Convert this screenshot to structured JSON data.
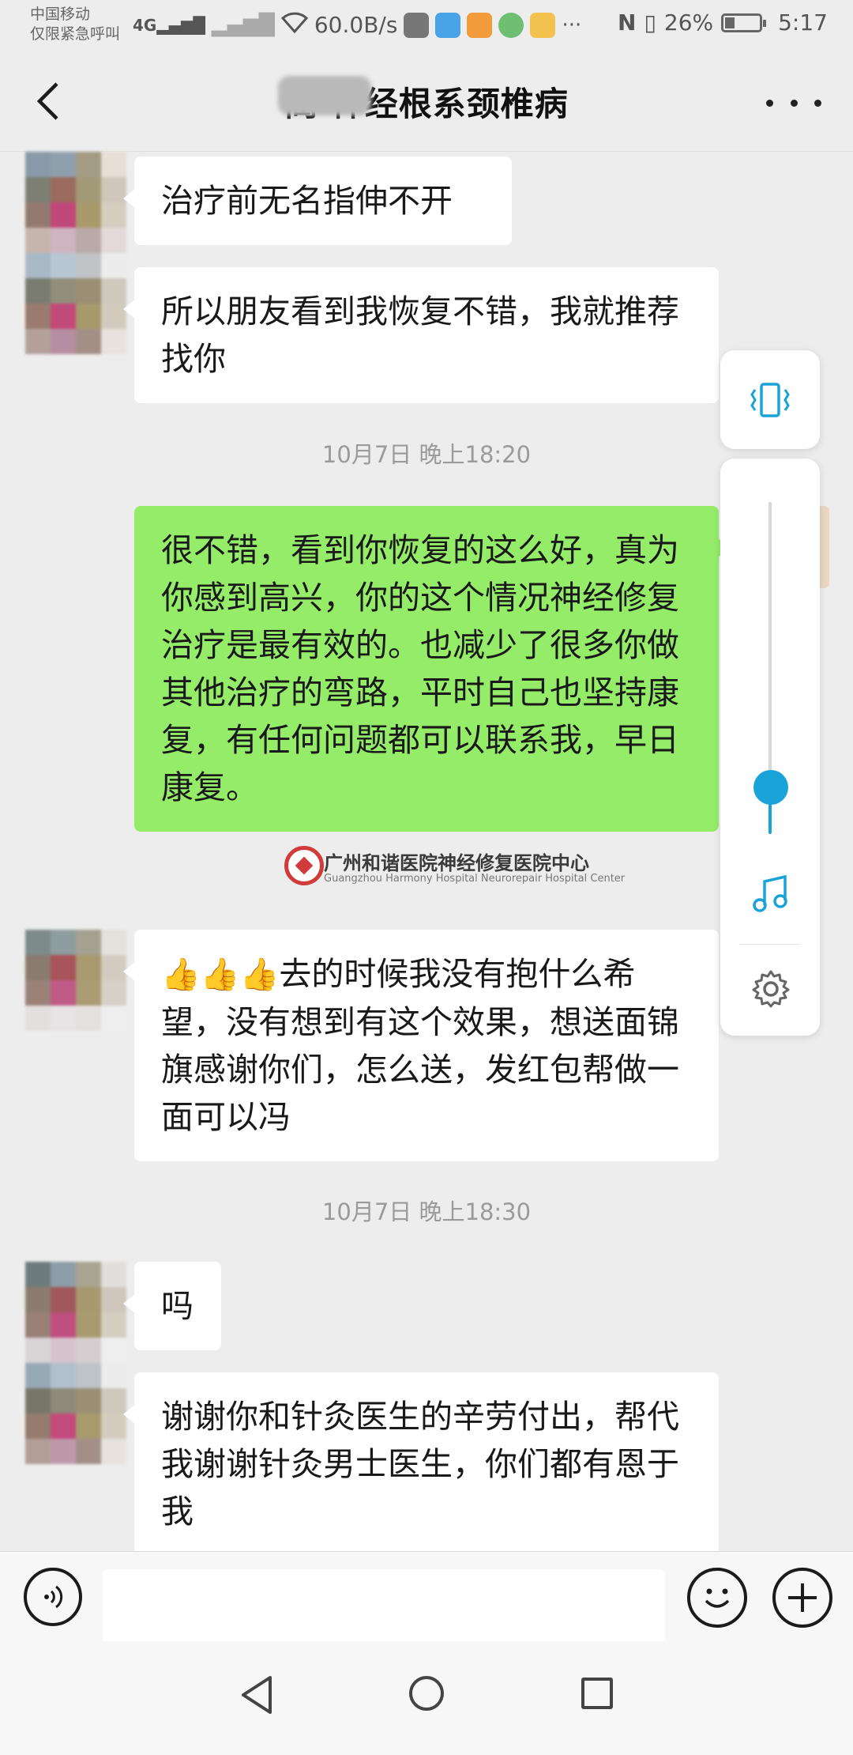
{
  "status_bar": {
    "carrier_line1": "中国移动",
    "carrier_line2": "仅限紧急呼叫",
    "network": "4G",
    "speed": "60.0B/s",
    "overflow": "···",
    "battery_pct": "26%",
    "time": "5:17",
    "icons": [
      "signal-icon",
      "wifi-icon",
      "wechat-icon",
      "weibo-icon",
      "nfc-icon",
      "vibrate-icon",
      "battery-icon"
    ]
  },
  "header": {
    "title": "蔺           神经根系颈椎病",
    "back_icon": "chevron-left-icon",
    "more_icon": "more-dots-icon"
  },
  "messages": [
    {
      "side": "left",
      "text": "治疗前无名指伸不开"
    },
    {
      "side": "left",
      "text": "所以朋友看到我恢复不错，我就推荐找你"
    },
    {
      "type": "time",
      "text": "10月7日 晚上18:20"
    },
    {
      "side": "right",
      "text": "很不错，看到你恢复的这么好，真为你感到高兴，你的这个情况神经修复治疗是最有效的。也减少了很多你做其他治疗的弯路，平时自己也坚持康复，有任何问题都可以联系我，早日康复。"
    },
    {
      "side": "left",
      "emoji": "👍👍👍",
      "text": "去的时候我没有抱什么希望，没有想到有这个效果，想送面锦旗感谢你们，怎么送，发红包帮做一面可以冯"
    },
    {
      "type": "time",
      "text": "10月7日 晚上18:30"
    },
    {
      "side": "left",
      "text": "吗"
    },
    {
      "side": "left",
      "text": "谢谢你和针灸医生的辛劳付出，帮代我谢谢针灸男士医生，你们都有恩于我"
    }
  ],
  "watermark": {
    "name": "广州和谐医院神经修复医院中心",
    "sub": "Guangzhou Harmony Hospital Neurorepair Hospital Center"
  },
  "volume_panel": {
    "level": 0.14,
    "accent": "#1aa3d9",
    "icons": [
      "vibrate-icon",
      "music-note-icon",
      "gear-icon"
    ]
  },
  "input_bar": {
    "placeholder": "",
    "icons": [
      "voice-icon",
      "emoji-icon",
      "plus-icon"
    ]
  },
  "colors": {
    "background": "#ededed",
    "bubble_left": "#ffffff",
    "bubble_right": "#95ec69"
  }
}
